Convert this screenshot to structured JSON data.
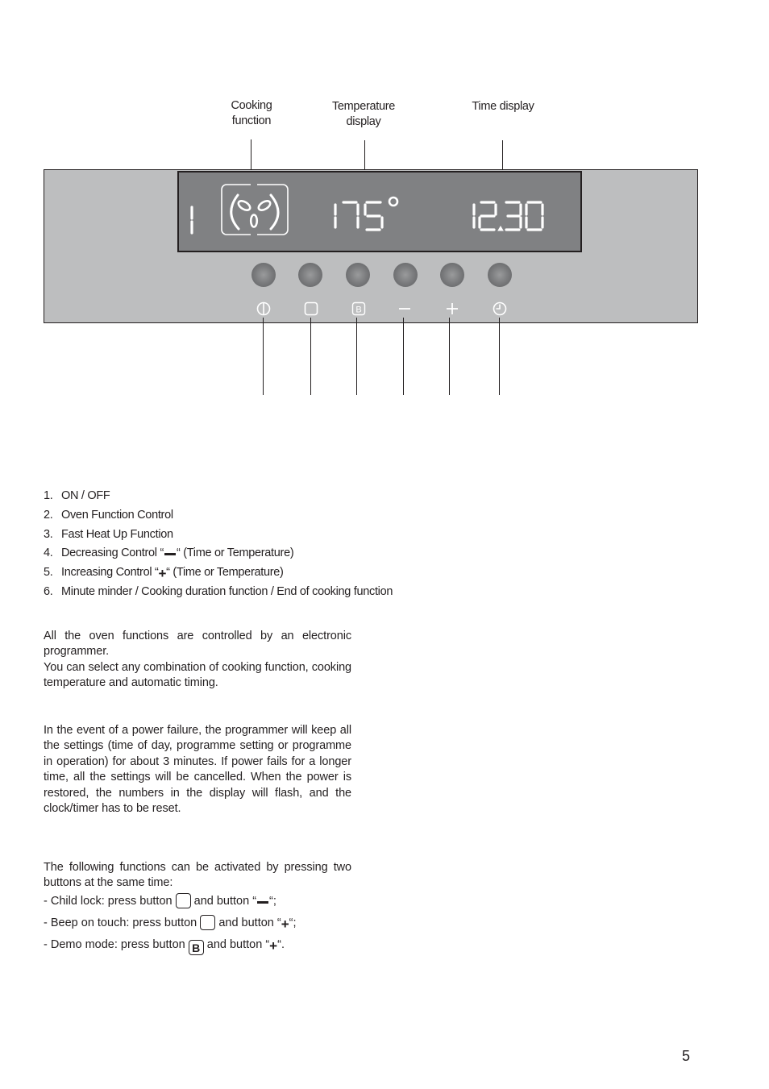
{
  "diagram": {
    "callouts": {
      "cooking_function": [
        "Cooking",
        "function"
      ],
      "temperature_display": [
        "Temperature",
        "display"
      ],
      "time_display": "Time display"
    },
    "lcd": {
      "program_number": "1",
      "temperature": "175°",
      "time": "12.30",
      "cooking_function_icon": "fan-icon"
    },
    "buttons": [
      {
        "id": 1,
        "icon": "power-icon"
      },
      {
        "id": 2,
        "icon": "square-icon"
      },
      {
        "id": 3,
        "icon": "b-icon",
        "glyph": "B"
      },
      {
        "id": 4,
        "icon": "minus-icon"
      },
      {
        "id": 5,
        "icon": "plus-icon"
      },
      {
        "id": 6,
        "icon": "clock-icon"
      }
    ]
  },
  "legend": [
    {
      "num": "1.",
      "text": "ON / OFF"
    },
    {
      "num": "2.",
      "text": "Oven Function Control"
    },
    {
      "num": "3.",
      "text": "Fast Heat Up Function"
    },
    {
      "num": "4.",
      "pre": "Decreasing Control “",
      "post": "“ (Time or Temperature)",
      "symbol": "minus"
    },
    {
      "num": "5.",
      "pre": "Increasing Control “",
      "post": "“ (Time or Temperature)",
      "symbol": "plus"
    },
    {
      "num": "6.",
      "text": "Minute minder / Cooking duration function / End of cooking function"
    }
  ],
  "paragraphs": {
    "intro_1": "All the oven functions are controlled by an electronic programmer.",
    "intro_2": "You can select any combination of cooking function, cooking temperature and automatic timing.",
    "power_failure": "In the event of a power failure, the programmer will keep all the settings (time of day, programme setting or programme in operation) for about 3 minutes. If power fails for a longer time, all the settings will be cancelled. When the power is restored, the numbers in the display will flash, and the clock/timer has to be reset.",
    "combos_intro": "The following functions can be activated by pressing two buttons at the same time:"
  },
  "combos": [
    {
      "label": "- Child lock: press button",
      "mid": "and button “",
      "end": "“;",
      "key": "",
      "symbol": "minus"
    },
    {
      "label": "- Beep on touch: press button",
      "mid": "and button “",
      "end": "“;",
      "key": "",
      "symbol": "plus"
    },
    {
      "label": "- Demo mode: press button",
      "mid": "and button “",
      "end": "“.",
      "key": "B",
      "symbol": "plus"
    }
  ],
  "symbols": {
    "plus": "+"
  },
  "page_number": "5"
}
